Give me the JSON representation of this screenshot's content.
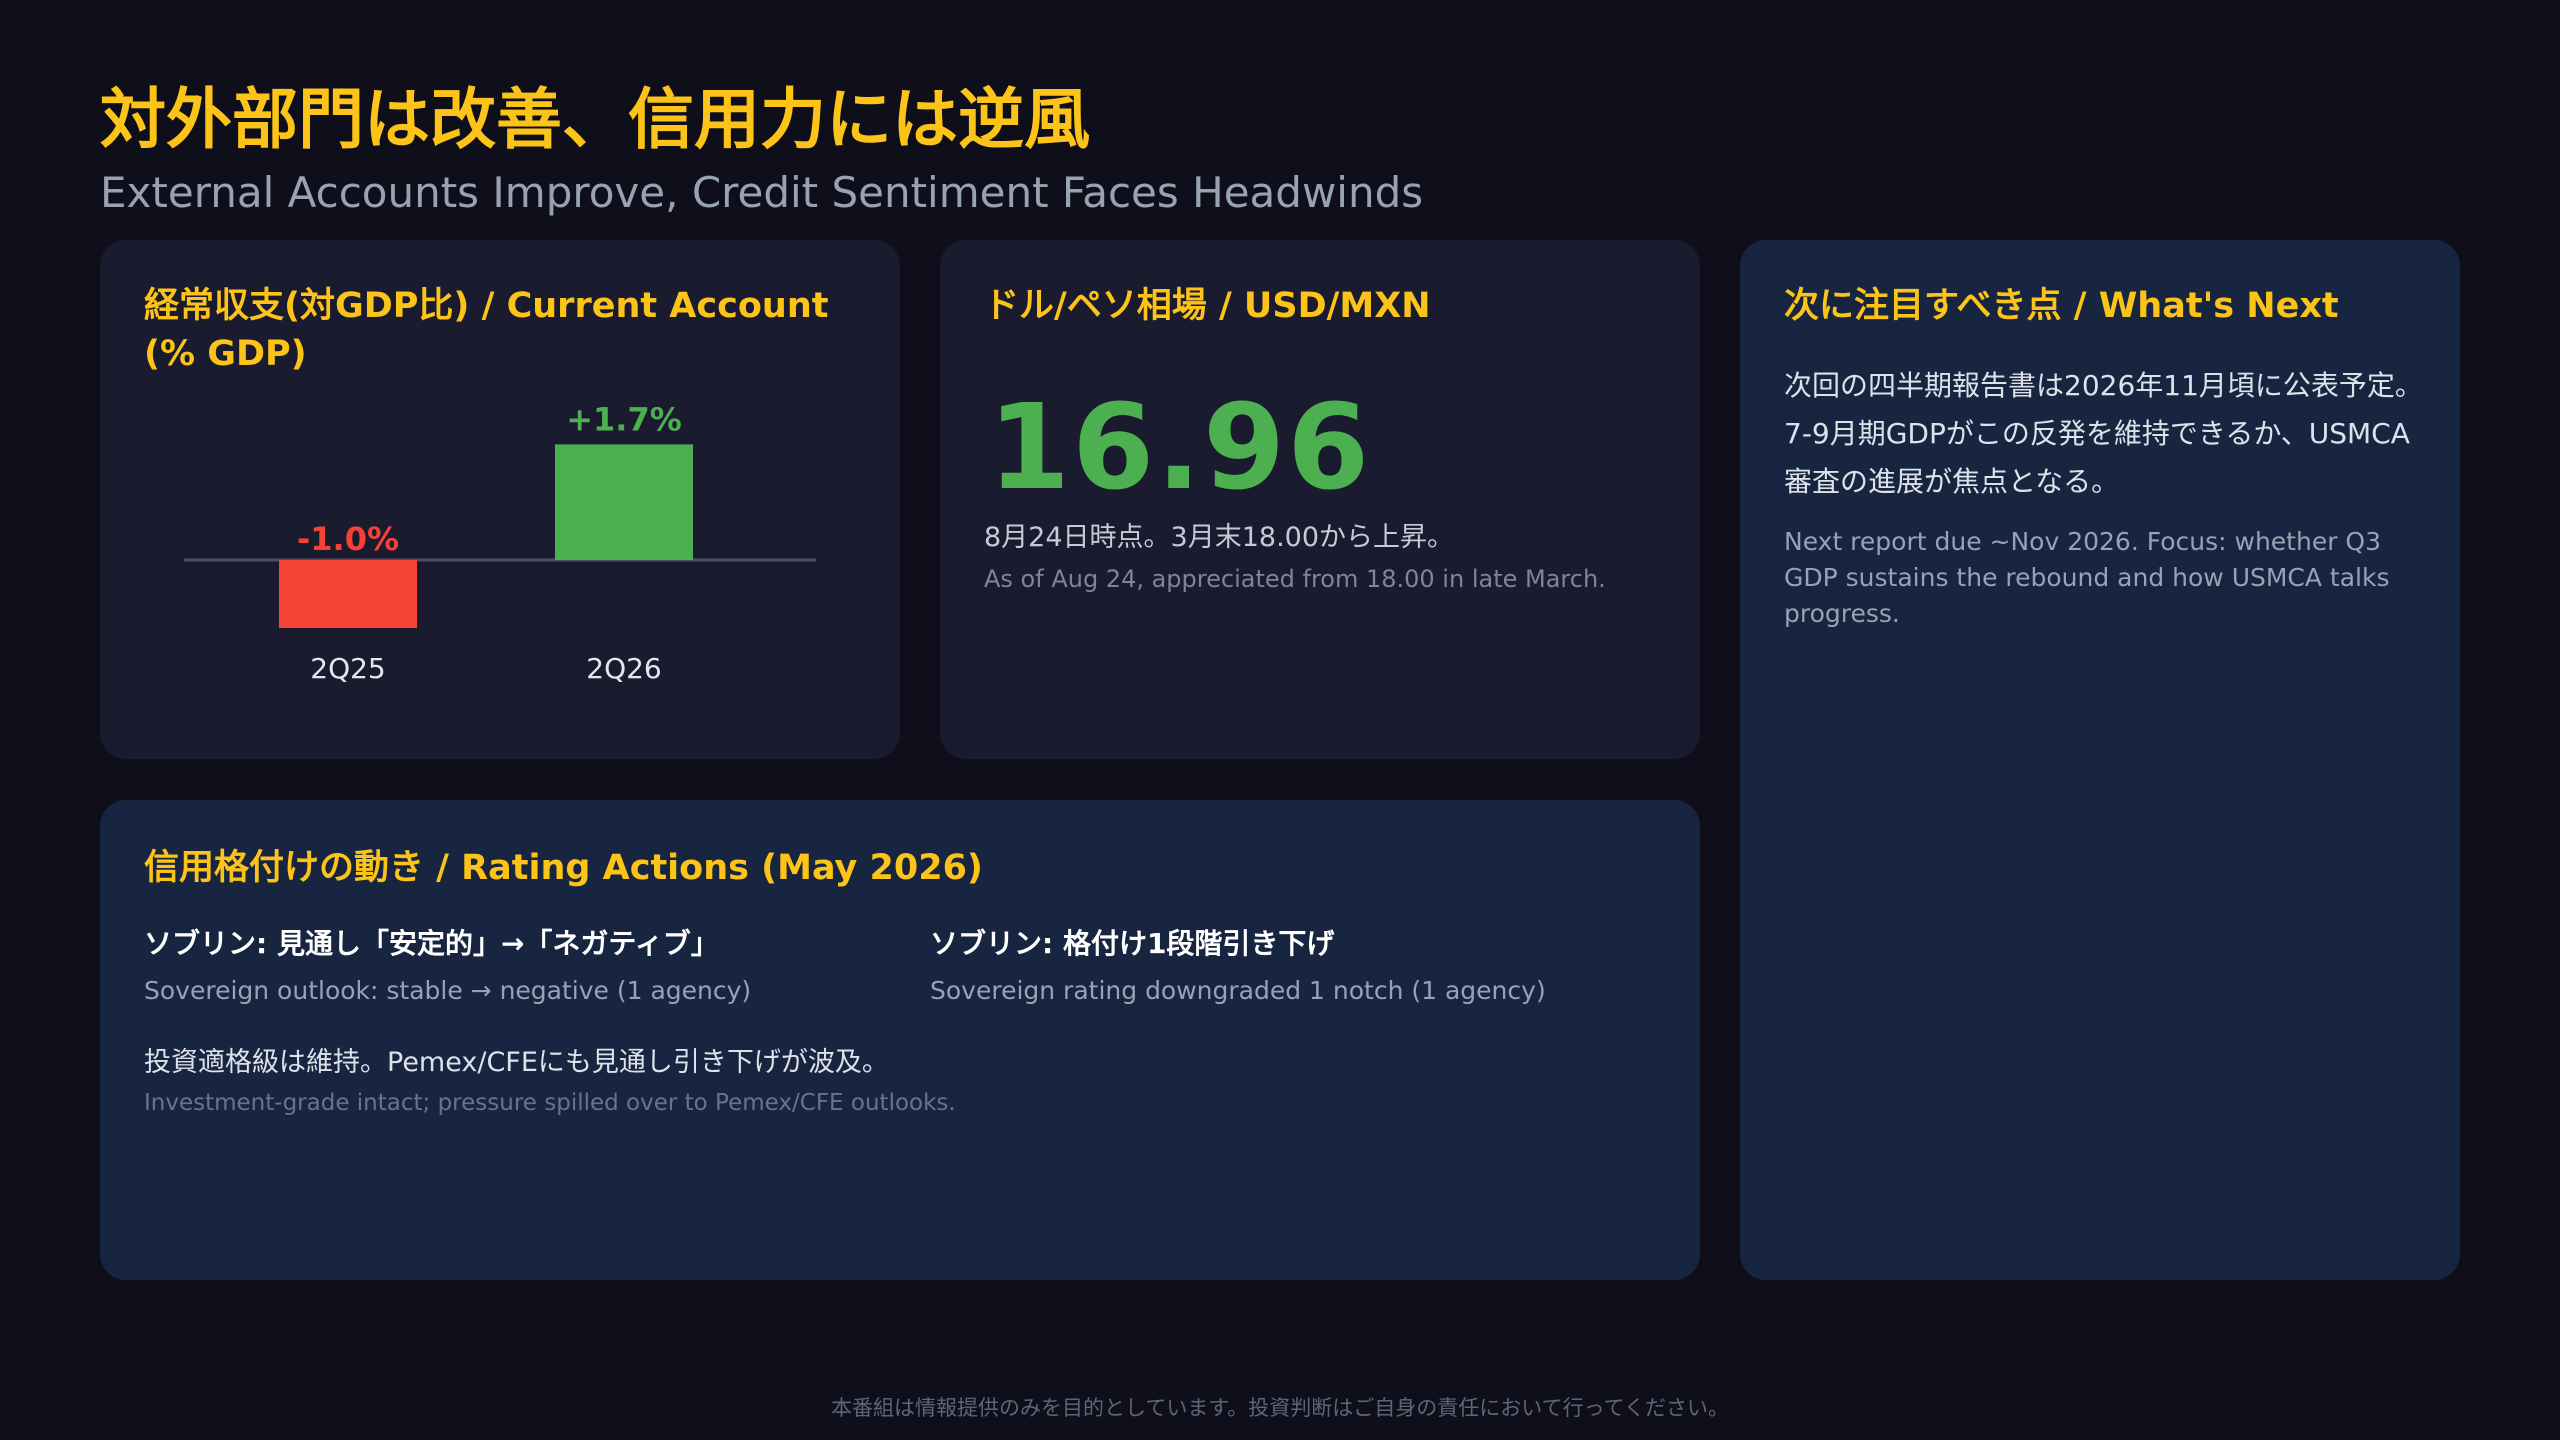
{
  "header": {
    "title": "対外部門は改善、信用力には逆風",
    "subtitle": "External Accounts Improve, Credit Sentiment Faces Headwinds"
  },
  "current_account": {
    "title": "経常収支(対GDP比) / Current Account (% GDP)"
  },
  "chart_data": {
    "type": "bar",
    "categories": [
      "2Q25",
      "2Q26"
    ],
    "values": [
      -1.0,
      1.7
    ],
    "data_labels": [
      "-1.0%",
      "+1.7%"
    ],
    "colors": [
      "#f44336",
      "#4caf50"
    ]
  },
  "fx": {
    "title": "ドル/ペソ相場 / USD/MXN",
    "value": "16.96",
    "note_jp": "8月24日時点。3月末18.00から上昇。",
    "note_en": "As of Aug 24, appreciated from 18.00 in late March.",
    "value_color": "#4caf50"
  },
  "whats_next": {
    "title": "次に注目すべき点 / What's Next",
    "text_jp": "次回の四半期報告書は2026年11月頃に公表予定。7-9月期GDPがこの反発を維持できるか、USMCA審査の進展が焦点となる。",
    "text_en": "Next report due ~Nov 2026. Focus: whether Q3 GDP sustains the rebound and how USMCA talks progress."
  },
  "rating": {
    "title": "信用格付けの動き / Rating Actions (May 2026)",
    "items": [
      {
        "jp": "ソブリン: 見通し「安定的」→「ネガティブ」",
        "en": "Sovereign outlook: stable → negative (1 agency)"
      },
      {
        "jp": "ソブリン: 格付け1段階引き下げ",
        "en": "Sovereign rating downgraded 1 notch (1 agency)"
      }
    ],
    "summary_jp": "投資適格級は維持。Pemex/CFEにも見通し引き下げが波及。",
    "summary_en": "Investment-grade intact; pressure spilled over to Pemex/CFE outlooks."
  },
  "footer": {
    "disclaimer": "本番組は情報提供のみを目的としています。投資判断はご自身の責任において行ってください。"
  },
  "colors": {
    "accent": "#fcc419",
    "positive": "#4caf50",
    "negative": "#f44336",
    "background": "#0f0f1b"
  }
}
